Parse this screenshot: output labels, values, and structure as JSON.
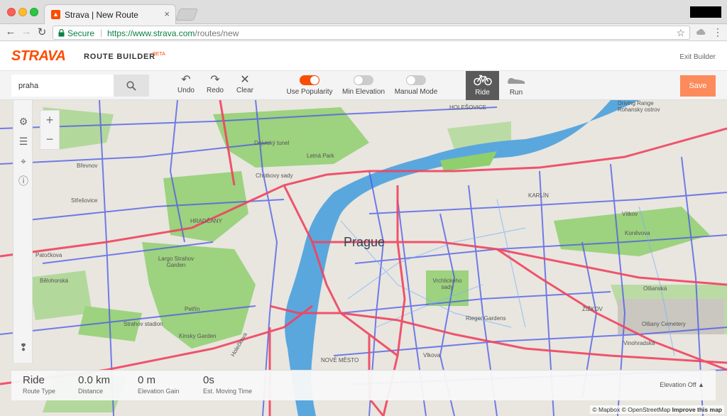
{
  "browser": {
    "tab_title": "Strava | New Route",
    "tab_close": "×",
    "secure_label": "Secure",
    "url_host": "https://www.strava.com",
    "url_path": "/routes/new",
    "nav_back": "←",
    "nav_forward": "→",
    "nav_reload": "↻",
    "star": "☆",
    "menu": "⋮"
  },
  "header": {
    "logo": "STRAVA",
    "title": "ROUTE BUILDER",
    "beta": "BETA",
    "exit": "Exit Builder"
  },
  "controls": {
    "search_value": "praha",
    "undo": "Undo",
    "redo": "Redo",
    "clear": "Clear",
    "toggles": [
      {
        "label": "Use Popularity",
        "on": true
      },
      {
        "label": "Min Elevation",
        "on": false
      },
      {
        "label": "Manual Mode",
        "on": false
      }
    ],
    "ride": "Ride",
    "run": "Run",
    "save": "Save"
  },
  "map": {
    "city": "Prague",
    "labels": [
      "HOLEŠOVICE",
      "Letná Park",
      "Chotkovy sady",
      "Dejvický tunel",
      "HRADČANY",
      "Střešovice",
      "Břevnov",
      "Patočkova",
      "Bělohorská",
      "Largo Strahov Garden",
      "Petřín",
      "Kinsky Garden",
      "Vrchlického sady",
      "Rieger Gardens",
      "KARLÍN",
      "Vítkov",
      "Koněvova",
      "Olšanská",
      "Olšany Cemetery",
      "Vinohradská",
      "ŽIŽKOV",
      "Holečkova",
      "Driving Range Rohansky ostrov",
      "NOVÉ MĚSTO",
      "Strahov stadion",
      "Vlkova"
    ],
    "zoom_in": "+",
    "zoom_out": "−",
    "attribution": "© Mapbox © OpenStreetMap",
    "improve": "Improve this map"
  },
  "stats": [
    {
      "value": "Ride",
      "label": "Route Type"
    },
    {
      "value": "0.0 km",
      "label": "Distance"
    },
    {
      "value": "0 m",
      "label": "Elevation Gain"
    },
    {
      "value": "0s",
      "label": "Est. Moving Time"
    }
  ],
  "elevation_toggle": "Elevation Off ▲",
  "colors": {
    "brand": "#fc4c02",
    "heat_red": "#f0435f",
    "heat_blue": "#4a56e8",
    "water": "#5aa7de",
    "park": "#8fcf6e"
  }
}
